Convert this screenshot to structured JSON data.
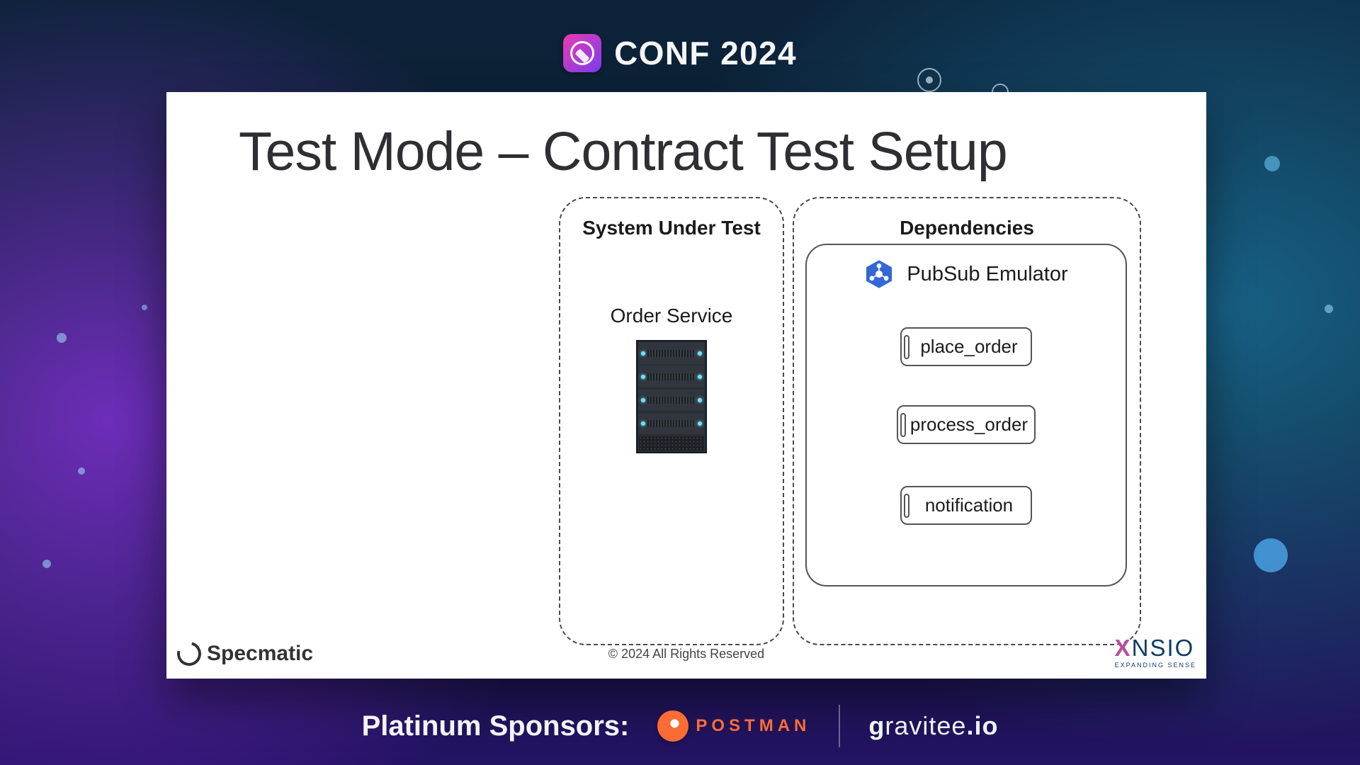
{
  "header": {
    "conference": "CONF 2024",
    "logo_name": "specmatic-conf-logo"
  },
  "slide": {
    "title": "Test Mode – Contract Test Setup",
    "sut": {
      "label": "System Under Test",
      "service": "Order Service"
    },
    "deps": {
      "label": "Dependencies",
      "emulator": {
        "name": "PubSub Emulator",
        "icon": "google-pubsub-icon"
      },
      "topics": [
        "place_order",
        "process_order",
        "notification"
      ]
    },
    "footer": {
      "product": "Specmatic",
      "copyright": "© 2024 All Rights Reserved",
      "company_logo": {
        "x": "X",
        "rest": "NSIO",
        "tag": "EXPANDING SENSE"
      }
    }
  },
  "sponsors": {
    "label": "Platinum Sponsors:",
    "items": [
      {
        "name": "POSTMAN",
        "logo": "postman-icon"
      },
      {
        "name_html": "gravitee.io",
        "logo": "gravitee-icon"
      }
    ]
  }
}
